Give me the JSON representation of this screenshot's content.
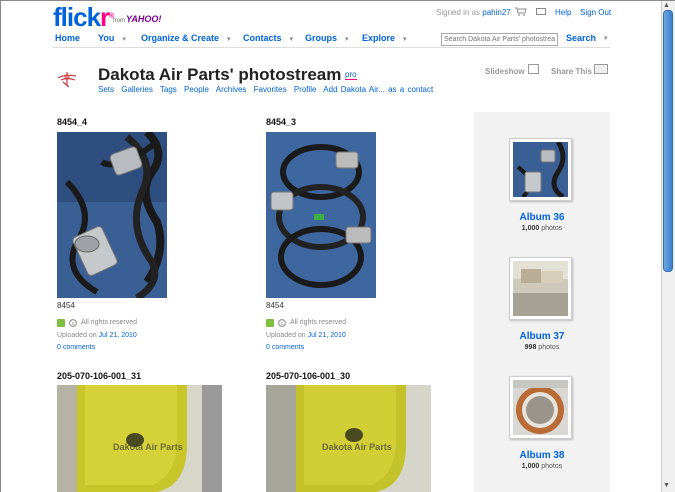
{
  "header": {
    "logo_main": "flick",
    "logo_r": "r",
    "from_text": "from",
    "yahoo": "YAHOO!",
    "signed_in_prefix": "Signed in as",
    "username": "pahin27",
    "help": "Help",
    "sign_out": "Sign Out"
  },
  "nav": {
    "home": "Home",
    "you": "You",
    "organize": "Organize & Create",
    "contacts": "Contacts",
    "groups": "Groups",
    "explore": "Explore",
    "search_placeholder": "Search Dakota Air Parts' photostream",
    "search_button": "Search"
  },
  "photostream": {
    "title": "Dakota Air Parts' photostream",
    "pro_badge": "pro",
    "links": [
      "Sets",
      "Galleries",
      "Tags",
      "People",
      "Archives",
      "Favorites",
      "Profile",
      "Add Dakota Air... as a contact"
    ],
    "slideshow": "Slideshow",
    "share": "Share This"
  },
  "photos": [
    {
      "title": "8454_4",
      "caption": "8454",
      "rights": "All rights reserved",
      "uploaded_prefix": "Uploaded on",
      "date": "Jul 21, 2010",
      "comments": "0 comments"
    },
    {
      "title": "8454_3",
      "caption": "8454",
      "rights": "All rights reserved",
      "uploaded_prefix": "Uploaded on",
      "date": "Jul 21, 2010",
      "comments": "0 comments"
    },
    {
      "title": "205-070-106-001_31",
      "watermark": "Dakota Air Parts"
    },
    {
      "title": "205-070-106-001_30",
      "watermark": "Dakota Air Parts"
    }
  ],
  "albums": [
    {
      "name": "Album 36",
      "count": "1,000",
      "unit": "photos"
    },
    {
      "name": "Album 37",
      "count": "998",
      "unit": "photos"
    },
    {
      "name": "Album 38",
      "count": "1,000",
      "unit": "photos"
    }
  ],
  "colors": {
    "brand_blue": "#0063dc",
    "brand_pink": "#ff0084"
  }
}
